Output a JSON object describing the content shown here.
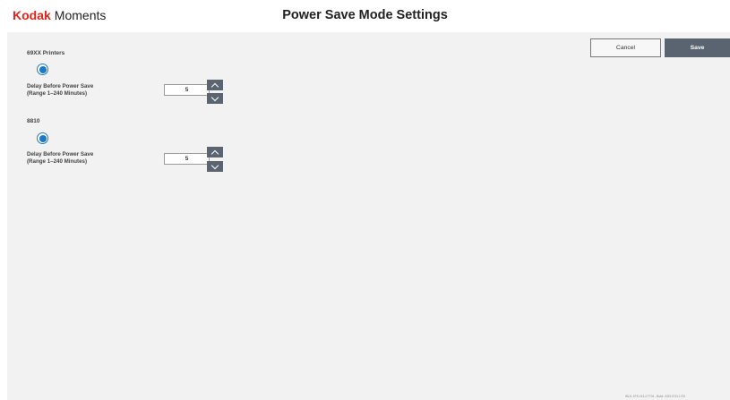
{
  "header": {
    "brand": "Kodak",
    "product": "Moments",
    "title": "Power Save Mode Settings"
  },
  "actions": {
    "cancel_label": "Cancel",
    "save_label": "Save"
  },
  "printers": [
    {
      "name": "69XX Printers",
      "selected": true,
      "delay_label_line1": "Delay Before Power Save",
      "delay_label_line2": "(Range 1–240 Minutes)",
      "delay_value": "5"
    },
    {
      "name": "8810",
      "selected": true,
      "delay_label_line1": "Delay Before Power Save",
      "delay_label_line2": "(Range 1–240 Minutes)",
      "delay_value": "5"
    }
  ],
  "icons": {
    "increment": "chevron-up-icon",
    "decrement": "chevron-down-icon"
  },
  "colors": {
    "brand_red": "#e2231a",
    "radio_blue": "#1c78c8",
    "primary_button": "#5a6470",
    "content_bg": "#f2f2f2"
  },
  "footer": {
    "version": "WLS: 1PS.V13.2.TT04 - Build: 2023.0731.1720"
  }
}
